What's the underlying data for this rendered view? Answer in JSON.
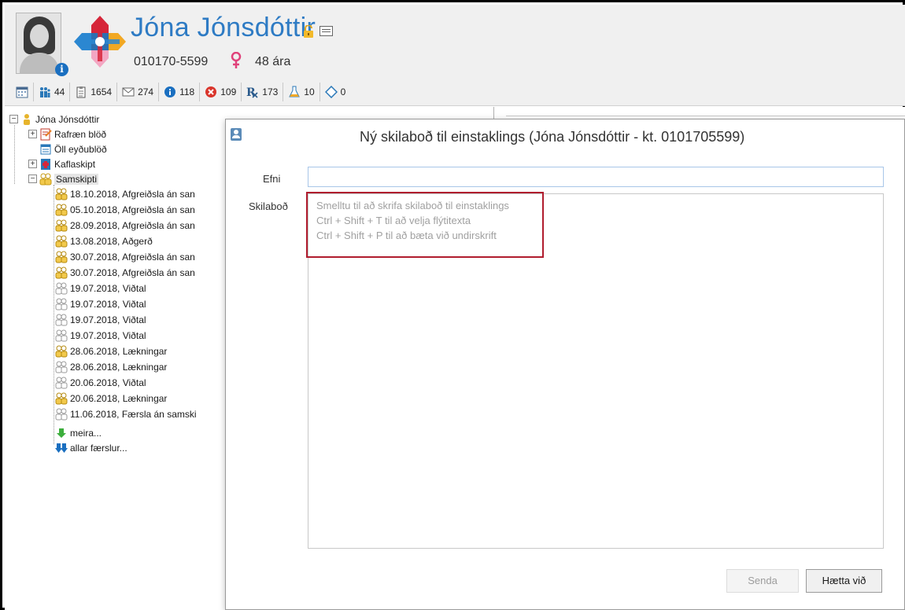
{
  "header": {
    "patient_name": "Jóna Jónsdóttir",
    "kennitala": "010170-5599",
    "age": "48 ára",
    "icons": [
      "avatar-female",
      "info-icon",
      "health-logo",
      "lock-icon",
      "card-icon",
      "female-symbol-icon"
    ]
  },
  "toolbar": {
    "items": [
      {
        "icon": "calendar-icon",
        "count": ""
      },
      {
        "icon": "people-icon",
        "count": "44"
      },
      {
        "icon": "clipboard-icon",
        "count": "1654"
      },
      {
        "icon": "envelope-icon",
        "count": "274"
      },
      {
        "icon": "info-icon",
        "count": "118"
      },
      {
        "icon": "error-icon",
        "count": "109"
      },
      {
        "icon": "rx-icon",
        "count": "173"
      },
      {
        "icon": "flask-icon",
        "count": "10"
      },
      {
        "icon": "diamond-icon",
        "count": "0"
      }
    ]
  },
  "tree": {
    "root": "Jóna Jónsdóttir",
    "nodes": [
      {
        "label": "Rafræn blöð"
      },
      {
        "label": "Öll eyðublöð"
      },
      {
        "label": "Kaflaskipt"
      },
      {
        "label": "Samskipti"
      }
    ],
    "samskipti_children": [
      {
        "label": "18.10.2018, Afgreiðsla án san",
        "active": true
      },
      {
        "label": "05.10.2018, Afgreiðsla án san",
        "active": true
      },
      {
        "label": "28.09.2018, Afgreiðsla án san",
        "active": true
      },
      {
        "label": "13.08.2018, Aðgerð",
        "active": true
      },
      {
        "label": "30.07.2018, Afgreiðsla án san",
        "active": true
      },
      {
        "label": "30.07.2018, Afgreiðsla án san",
        "active": true
      },
      {
        "label": "19.07.2018, Viðtal",
        "active": false
      },
      {
        "label": "19.07.2018, Viðtal",
        "active": false
      },
      {
        "label": "19.07.2018, Viðtal",
        "active": false
      },
      {
        "label": "19.07.2018, Viðtal",
        "active": false
      },
      {
        "label": "28.06.2018, Lækningar",
        "active": true
      },
      {
        "label": "28.06.2018, Lækningar",
        "active": false
      },
      {
        "label": "20.06.2018, Viðtal",
        "active": false
      },
      {
        "label": "20.06.2018, Lækningar",
        "active": true
      },
      {
        "label": "11.06.2018, Færsla án samski",
        "active": false
      }
    ],
    "more": "meira...",
    "all": "allar færslur..."
  },
  "dialog": {
    "title": "Ný skilaboð til einstaklings (Jóna Jónsdóttir - kt. 0101705599)",
    "subject_label": "Efni",
    "subject_value": "",
    "message_label": "Skilaboð",
    "placeholder_lines": [
      "Smelltu til að skrifa skilaboð til einstaklings",
      "Ctrl + Shift + T til að velja flýtitexta",
      "Ctrl + Shift + P til að bæta við undirskrift"
    ],
    "send_label": "Senda",
    "cancel_label": "Hætta við"
  },
  "colors": {
    "name_blue": "#2e7bc4",
    "highlight_red": "#b01c2e",
    "input_border": "#a8c6e8"
  }
}
